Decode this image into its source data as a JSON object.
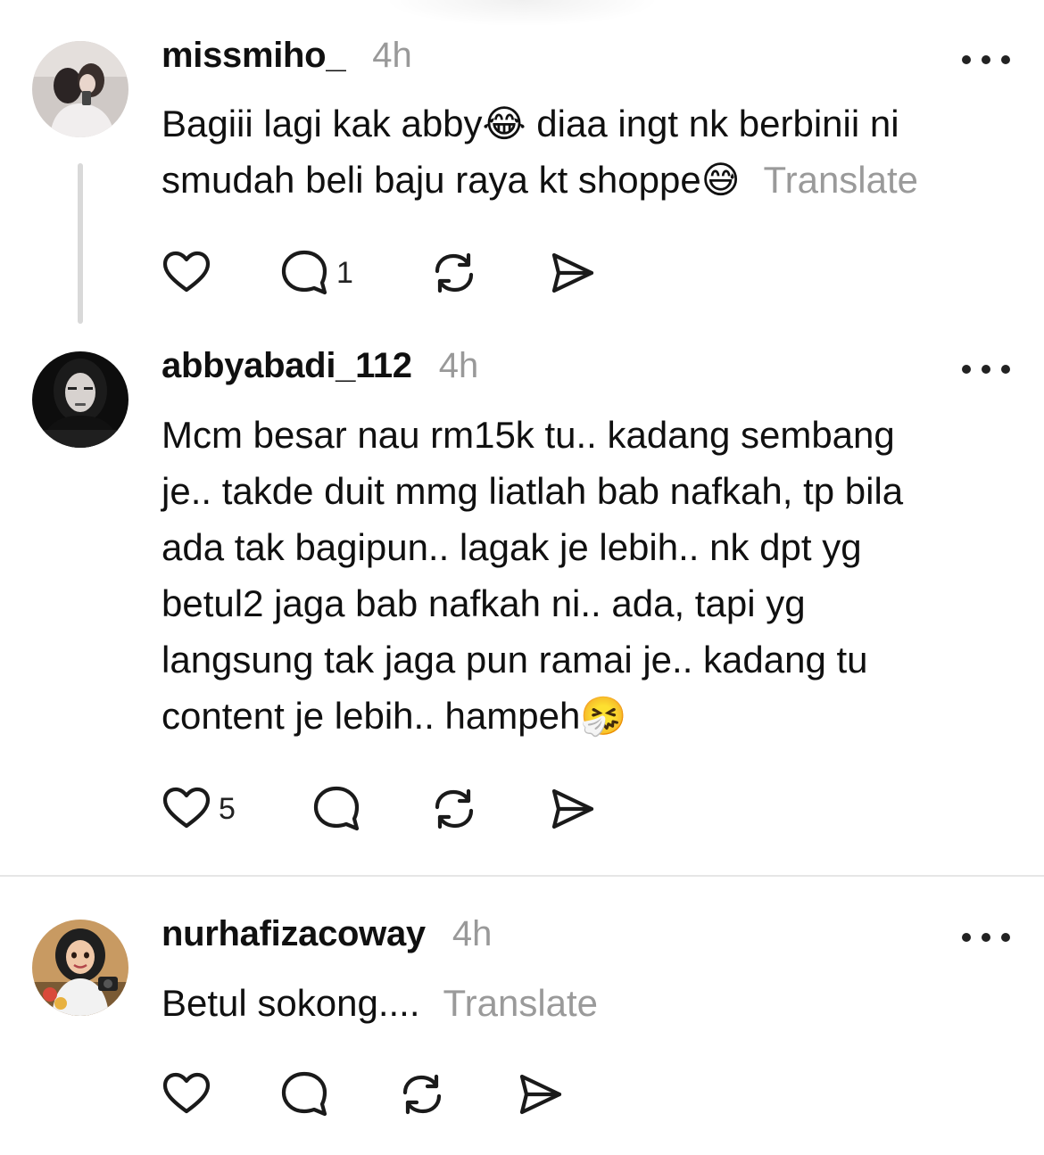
{
  "posts": [
    {
      "username": "missmiho_",
      "time": "4h",
      "text": "Bagiii lagi kak abby😂 diaa ingt nk berbinii ni\nsmudah beli baju raya kt shoppe😅",
      "translate": "Translate",
      "reply_count": "1",
      "like_count": ""
    },
    {
      "username": "abbyabadi_112",
      "time": "4h",
      "text": "Mcm besar nau rm15k tu.. kadang sembang\nje.. takde duit mmg liatlah bab nafkah, tp bila\nada tak bagipun.. lagak je lebih.. nk dpt yg\nbetul2 jaga bab nafkah ni.. ada, tapi yg\nlangsung tak jaga pun ramai je.. kadang tu\ncontent je lebih.. hampeh🤧",
      "translate": "",
      "reply_count": "",
      "like_count": "5"
    },
    {
      "username": "nurhafizacoway",
      "time": "4h",
      "text": "Betul sokong....",
      "translate": "Translate",
      "reply_count": "",
      "like_count": ""
    }
  ],
  "icons": {
    "like": "heart-icon",
    "reply": "comment-icon",
    "repost": "repost-icon",
    "share": "send-icon",
    "more": "more-icon"
  }
}
